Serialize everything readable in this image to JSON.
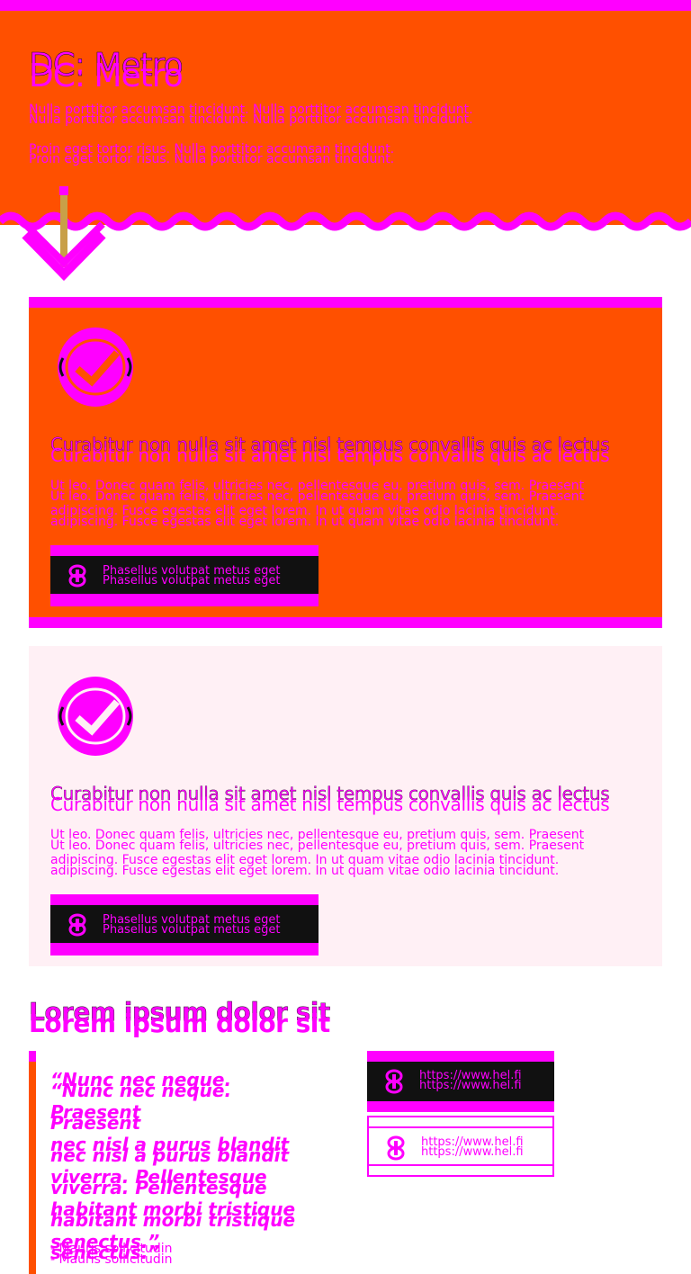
{
  "colors": {
    "accent": "#ff00ff",
    "hero_bg": "#ff5000",
    "dark": "#111111",
    "card_light_bg": "#fff0f5",
    "arrow_shaft": "#c8a048"
  },
  "hero": {
    "title": "DC: Metro",
    "paragraph_1": "Nulla porttitor accumsan tincidunt. Nulla porttitor accumsan tincidunt.",
    "paragraph_2": "Proin eget tortor risus. Nulla porttitor accumsan tincidunt."
  },
  "cards": [
    {
      "icon": "check-circle-icon",
      "title": "Curabitur non nulla sit amet nisl tempus convallis quis ac lectus",
      "body_line_1": "Ut leo. Donec quam felis, ultricies nec, pellentesque eu, pretium quis, sem. Praesent",
      "body_line_2": "adipiscing. Fusce egestas elit eget lorem. In ut quam vitae odio lacinia tincidunt.",
      "button_label": "Phasellus volutpat metus eget",
      "button_icon": "link-chain-icon"
    },
    {
      "icon": "check-circle-icon",
      "title": "Curabitur non nulla sit amet nisl tempus convallis quis ac lectus",
      "body_line_1": "Ut leo. Donec quam felis, ultricies nec, pellentesque eu, pretium quis, sem. Praesent",
      "body_line_2": "adipiscing. Fusce egestas elit eget lorem. In ut quam vitae odio lacinia tincidunt.",
      "button_label": "Phasellus volutpat metus eget",
      "button_icon": "link-chain-icon"
    }
  ],
  "section": {
    "title": "Lorem ipsum dolor sit",
    "quote_lines": [
      "“Nunc nec neque. Praesent",
      "nec nisl a purus blandit",
      "viverra. Pellentesque",
      "habitant morbi tristique",
      "senectus.”"
    ],
    "quote_author": "- Mauris sollicitudin",
    "links": [
      {
        "label": "https://www.hel.fi",
        "icon": "link-chain-icon"
      },
      {
        "label": "https://www.hel.fi",
        "icon": "link-chain-icon"
      }
    ]
  }
}
